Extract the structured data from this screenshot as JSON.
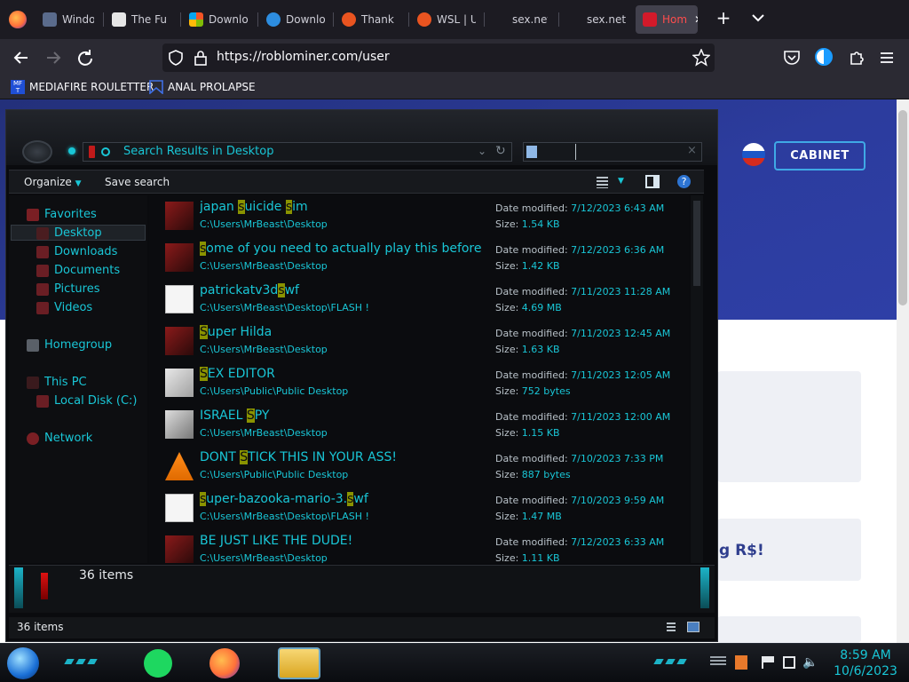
{
  "browser": {
    "tabs": [
      {
        "label": "Windo",
        "icon": "windows-icon"
      },
      {
        "label": "The Fu",
        "icon": "museum-icon"
      },
      {
        "label": "Downlo",
        "icon": "microsoft-icon"
      },
      {
        "label": "Downlo",
        "icon": "globe-icon"
      },
      {
        "label": "Thank",
        "icon": "ubuntu-icon"
      },
      {
        "label": "WSL | U",
        "icon": "ubuntu-icon"
      },
      {
        "label": "sex.net",
        "icon": ""
      },
      {
        "label": "sex.net don",
        "icon": ""
      },
      {
        "label": "Hom",
        "icon": "ruby-icon",
        "active": true
      }
    ],
    "url": "https://roblominer.com/user",
    "bookmarks": [
      {
        "label": "MEDIAFIRE ROULETTER",
        "icon": "mediafire-icon"
      },
      {
        "label": "ANAL PROLAPSE",
        "icon": "bookmark-icon"
      }
    ]
  },
  "webpage": {
    "cabinet_button": "CABINET",
    "partial_text": "g R$!"
  },
  "explorer": {
    "address": "Search Results in Desktop",
    "toolbar": {
      "organize": "Organize",
      "save_search": "Save search"
    },
    "nav": {
      "favorites": "Favorites",
      "desktop": "Desktop",
      "downloads": "Downloads",
      "documents": "Documents",
      "pictures": "Pictures",
      "videos": "Videos",
      "homegroup": "Homegroup",
      "this_pc": "This PC",
      "local_disk": "Local Disk (C:)",
      "network": "Network"
    },
    "date_label": "Date modified:",
    "size_label": "Size:",
    "files": [
      {
        "name_parts": [
          "japan ",
          "s",
          "uicide ",
          "s",
          "im"
        ],
        "path": "C:\\Users\\MrBeast\\Desktop",
        "date": "7/12/2023 6:43 AM",
        "size": "1.54 KB",
        "icon": "game-shortcut-icon"
      },
      {
        "name_parts": [
          "",
          "s",
          "ome of you need to actually play this before usin..."
        ],
        "path": "C:\\Users\\MrBeast\\Desktop",
        "date": "7/12/2023 6:36 AM",
        "size": "1.42 KB",
        "icon": "game-shortcut-icon"
      },
      {
        "name_parts": [
          "patrickatv3d",
          "s",
          "wf"
        ],
        "path": "C:\\Users\\MrBeast\\Desktop\\FLASH !",
        "date": "7/11/2023 11:28 AM",
        "size": "4.69 MB",
        "icon": "flash-file-icon"
      },
      {
        "name_parts": [
          "",
          "S",
          "uper Hilda"
        ],
        "path": "C:\\Users\\MrBeast\\Desktop",
        "date": "7/11/2023 12:45 AM",
        "size": "1.63 KB",
        "icon": "game-shortcut-icon"
      },
      {
        "name_parts": [
          "",
          "S",
          "EX EDITOR"
        ],
        "path": "C:\\Users\\Public\\Public Desktop",
        "date": "7/11/2023 12:05 AM",
        "size": "752 bytes",
        "icon": "editor-shortcut-icon"
      },
      {
        "name_parts": [
          "ISRAEL ",
          "S",
          "PY"
        ],
        "path": "C:\\Users\\MrBeast\\Desktop",
        "date": "7/11/2023 12:00 AM",
        "size": "1.15 KB",
        "icon": "spy-shortcut-icon"
      },
      {
        "name_parts": [
          "DONT ",
          "S",
          "TICK THIS IN YOUR ASS!"
        ],
        "path": "C:\\Users\\Public\\Public Desktop",
        "date": "7/10/2023 7:33 PM",
        "size": "887 bytes",
        "icon": "vlc-icon"
      },
      {
        "name_parts": [
          "",
          "s",
          "uper-bazooka-mario-3.",
          "s",
          "wf"
        ],
        "path": "C:\\Users\\MrBeast\\Desktop\\FLASH !",
        "date": "7/10/2023 9:59 AM",
        "size": "1.47 MB",
        "icon": "flash-file-icon"
      },
      {
        "name_parts": [
          "BE JUST LIKE THE DUDE!"
        ],
        "path": "C:\\Users\\MrBeast\\Desktop",
        "date": "7/12/2023 6:33 AM",
        "size": "1.11 KB",
        "icon": "game-shortcut-icon"
      }
    ],
    "details_count": "36 items",
    "status_count": "36 items"
  },
  "taskbar": {
    "time": "8:59 AM",
    "date": "10/6/2023"
  },
  "colors": {
    "accent": "#19c6d6",
    "highlight": "#8a9300",
    "brand_blue": "#2c3c9e"
  }
}
